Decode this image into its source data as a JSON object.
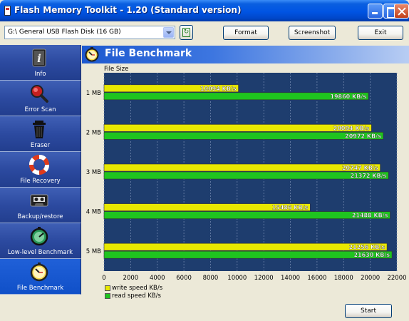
{
  "window": {
    "title": "Flash Memory Toolkit - 1.20 (Standard version)"
  },
  "toolbar": {
    "drive_value": "G:\\ General USB Flash Disk (16 GB)",
    "refresh_glyph": "↻",
    "format_label": "Format",
    "screenshot_label": "Screenshot",
    "exit_label": "Exit"
  },
  "sidebar": {
    "items": [
      {
        "label": "Info",
        "icon": "info-icon",
        "active": false
      },
      {
        "label": "Error Scan",
        "icon": "magnifier-icon",
        "active": false
      },
      {
        "label": "Eraser",
        "icon": "trash-icon",
        "active": false
      },
      {
        "label": "File Recovery",
        "icon": "lifebuoy-icon",
        "active": false
      },
      {
        "label": "Backup/restore",
        "icon": "cassette-icon",
        "active": false
      },
      {
        "label": "Low-level Benchmark",
        "icon": "gauge-icon",
        "active": false
      },
      {
        "label": "File Benchmark",
        "icon": "stopwatch-icon",
        "active": true
      }
    ]
  },
  "content": {
    "title": "File Benchmark",
    "start_label": "Start"
  },
  "chart_data": {
    "type": "bar",
    "orientation": "horizontal",
    "ylabel": "File Size",
    "categories": [
      "1 MB",
      "2 MB",
      "3 MB",
      "4 MB",
      "5 MB"
    ],
    "series": [
      {
        "name": "write speed KB/s",
        "color": "#e8e800",
        "values": [
          10094,
          20094,
          20747,
          15486,
          21256
        ],
        "labels": [
          "10094 KB/s",
          "20094 KB/s",
          "20747 KB/s",
          "15486 KB/s",
          "21256 KB/s"
        ]
      },
      {
        "name": "read speed KB/s",
        "color": "#1fc41f",
        "values": [
          19860,
          20972,
          21372,
          21488,
          21630
        ],
        "labels": [
          "19860 KB/s",
          "20972 KB/s",
          "21372 KB/s",
          "21488 KB/s",
          "21630 KB/s"
        ]
      }
    ],
    "xlim": [
      0,
      22000
    ],
    "xticks": [
      "0",
      "2000",
      "4000",
      "6000",
      "8000",
      "10000",
      "12000",
      "14000",
      "16000",
      "18000",
      "20000",
      "22000"
    ],
    "background": "#1e3d6e",
    "grid": true
  }
}
